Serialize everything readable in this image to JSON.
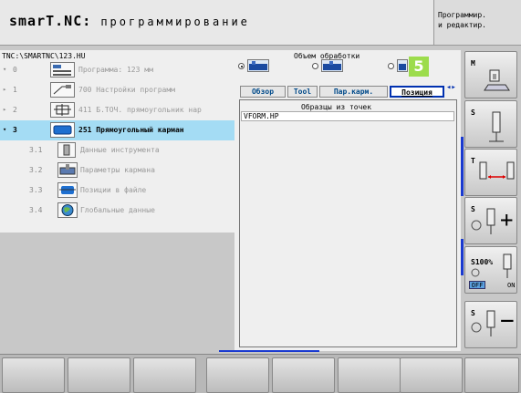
{
  "header": {
    "app_name": "smarT.NC:",
    "subtitle": "программирование",
    "mode_line1": "Программир.",
    "mode_line2": "и редактир."
  },
  "tree": {
    "path": "TNC:\\SMARTNC\\123.HU",
    "items": [
      {
        "expander": "▾",
        "number": "0",
        "label": "Программа: 123 мм",
        "icon": "program-icon",
        "selected": false
      },
      {
        "expander": "▸",
        "number": "1",
        "label": "700 Настройки программ",
        "icon": "settings-icon",
        "selected": false
      },
      {
        "expander": "▸",
        "number": "2",
        "label": "411 Б.ТОЧ. прямоугольник нар",
        "icon": "datum-icon",
        "selected": false
      },
      {
        "expander": "▾",
        "number": "3",
        "label": "251 Прямоугольный карман",
        "icon": "pocket-icon",
        "selected": true
      },
      {
        "expander": "",
        "number": "3.1",
        "label": "Данные инструмента",
        "icon": "tool-icon",
        "selected": false
      },
      {
        "expander": "",
        "number": "3.2",
        "label": "Параметры кармана",
        "icon": "pocket-params-icon",
        "selected": false
      },
      {
        "expander": "",
        "number": "3.3",
        "label": "Позиции в файле",
        "icon": "positions-icon",
        "selected": false
      },
      {
        "expander": "",
        "number": "3.4",
        "label": "Глобальные данные",
        "icon": "global-icon",
        "selected": false
      }
    ]
  },
  "form": {
    "machining_label": "Объем обработки",
    "step_badge": "5",
    "tabs": [
      "Обзор",
      "Tool",
      "Пар.карм.",
      "Позиция"
    ],
    "active_tab": "Позиция",
    "pattern_label": "Образцы из точек",
    "pattern_value": "VFORM.HP"
  },
  "softkeys_right": {
    "m_label": "M",
    "s_label": "S",
    "t_label": "T",
    "s_plus_label": "S",
    "s100_label": "S100%",
    "off_label": "OFF",
    "on_label": "ON",
    "s_minus_label": "S"
  },
  "colors": {
    "selected_row": "#a4dcf4",
    "active_tab_border": "#0030b0",
    "badge": "#9cdc4c"
  }
}
